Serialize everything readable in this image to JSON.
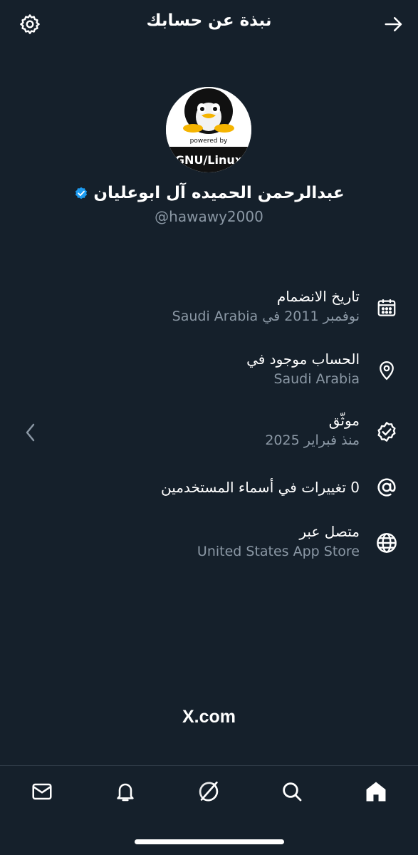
{
  "header": {
    "title": "نبذة عن حسابك",
    "back_icon": "arrow-right-icon",
    "settings_icon": "gear-icon"
  },
  "profile": {
    "name": "عبدالرحمن الحميده آل ابوعليان",
    "handle": "@hawawy2000",
    "verified": true,
    "avatar_caption": "powered by",
    "avatar_text": "GNU/Linux"
  },
  "info": [
    {
      "icon": "calendar-icon",
      "title": "تاريخ الانضمام",
      "subtitle": "نوفمبر 2011 في Saudi Arabia"
    },
    {
      "icon": "location-pin-icon",
      "title": "الحساب موجود في",
      "subtitle": "Saudi Arabia"
    },
    {
      "icon": "verified-badge-icon",
      "title": "موثّق",
      "subtitle": "منذ فبراير 2025"
    },
    {
      "icon": "at-sign-icon",
      "title": "0 تغييرات في أسماء المستخدمين",
      "subtitle": ""
    },
    {
      "icon": "globe-icon",
      "title": "متصل عبر",
      "subtitle": "United States App Store"
    }
  ],
  "footer": {
    "brand": "X.com"
  },
  "tabs": [
    "mail-icon",
    "bell-icon",
    "grok-icon",
    "search-icon",
    "home-icon"
  ],
  "colors": {
    "background": "#15202b",
    "secondary_text": "#8b98a5",
    "verified_blue": "#1d9bf0"
  }
}
